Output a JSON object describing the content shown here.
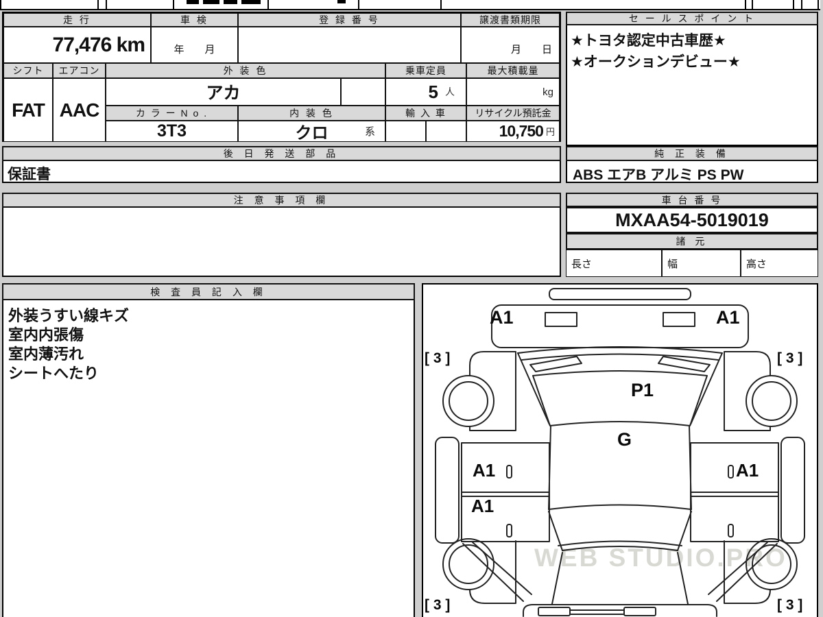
{
  "colors": {
    "page_bg": "#cfcfcf",
    "header_bg": "#d9d9d9",
    "border": "#000000"
  },
  "vehicle_table": {
    "headers": {
      "mileage": "走 行",
      "inspection": "車 検",
      "registration_no": "登 録 番 号",
      "transfer_deadline": "譲渡書類期限",
      "shift": "シフト",
      "aircon": "エアコン",
      "exterior_color": "外 装 色",
      "capacity": "乗車定員",
      "max_load": "最大積載量",
      "color_no": "カ ラ ー N o .",
      "interior_color": "内 装 色",
      "import_car": "輸 入 車",
      "recycle_deposit": "リサイクル預託金"
    },
    "values": {
      "mileage": "77,476 km",
      "inspection_unit": "年　　月",
      "registration_no": "",
      "transfer_unit": "月　　日",
      "shift": "FAT",
      "aircon": "AAC",
      "exterior_color": "アカ",
      "capacity": "5",
      "capacity_unit": "人",
      "max_load_unit": "kg",
      "color_no": "3T3",
      "interior_color": "クロ",
      "interior_color_suffix": "系",
      "recycle_deposit": "10,750",
      "recycle_unit": "円"
    }
  },
  "sales_point": {
    "header": "セ ー ル ス ポ イ ン ト",
    "lines": [
      "★トヨタ認定中古車歴★",
      "★オークションデビュー★"
    ]
  },
  "later_parts": {
    "header": "後 日 発 送 部 品",
    "value": "保証書"
  },
  "genuine_equipment": {
    "header": "純 正 装 備",
    "value": "ABS エアB アルミ PS PW"
  },
  "notes": {
    "header": "注 意 事 項 欄",
    "value": ""
  },
  "chassis": {
    "header": "車 台 番 号",
    "value": "MXAA54-5019019"
  },
  "specs": {
    "header": "諸 元",
    "length_label": "長さ",
    "width_label": "幅",
    "height_label": "高さ",
    "length_value": "",
    "width_value": "",
    "height_value": ""
  },
  "inspector": {
    "header": "検 査 員 記 入 欄",
    "lines": [
      "外装うすい線キズ",
      "室内内張傷",
      "室内薄汚れ",
      "シートへたり"
    ]
  },
  "diagram": {
    "watermark": "WEB STUDIO.PRO",
    "marks": {
      "bumper_left": "A1",
      "bumper_right": "A1",
      "front_corner_left": "[ 3 ]",
      "front_corner_right": "[ 3 ]",
      "windshield": "P1",
      "roof": "G",
      "door_front_left": "A1",
      "door_rear_left": "A1",
      "door_front_right": "A1",
      "rear_corner_left": "[ 3 ]",
      "rear_corner_right": "[ 3 ]"
    }
  }
}
